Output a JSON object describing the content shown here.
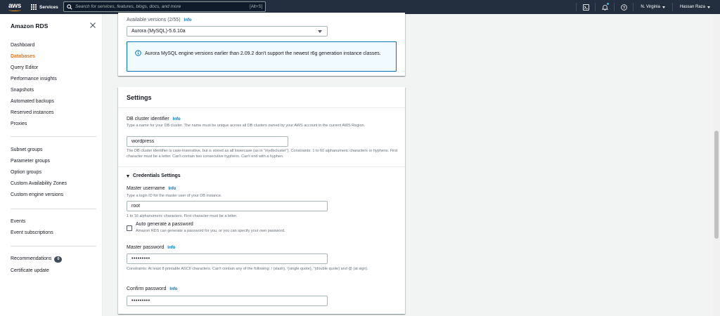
{
  "topnav": {
    "logo_text": "aws",
    "services_label": "Services",
    "search_placeholder": "Search for services, features, blogs, docs, and more",
    "search_shortcut": "[Alt+S]",
    "region": "N. Virginia",
    "user": "Hassan Raza",
    "icons": [
      "cloudshell-icon",
      "bell-icon",
      "help-icon"
    ],
    "notification_dot_color": "#44b9d6"
  },
  "sidebar": {
    "title": "Amazon RDS",
    "groups": [
      [
        {
          "label": "Dashboard",
          "active": false
        },
        {
          "label": "Databases",
          "active": true
        },
        {
          "label": "Query Editor",
          "active": false
        },
        {
          "label": "Performance insights",
          "active": false
        },
        {
          "label": "Snapshots",
          "active": false
        },
        {
          "label": "Automated backups",
          "active": false
        },
        {
          "label": "Reserved instances",
          "active": false
        },
        {
          "label": "Proxies",
          "active": false
        }
      ],
      [
        {
          "label": "Subnet groups",
          "active": false
        },
        {
          "label": "Parameter groups",
          "active": false
        },
        {
          "label": "Option groups",
          "active": false
        },
        {
          "label": "Custom Availability Zones",
          "active": false
        },
        {
          "label": "Custom engine versions",
          "active": false
        }
      ],
      [
        {
          "label": "Events",
          "active": false
        },
        {
          "label": "Event subscriptions",
          "active": false
        }
      ],
      [
        {
          "label": "Recommendations",
          "active": false,
          "badge": "0"
        },
        {
          "label": "Certificate update",
          "active": false
        }
      ]
    ],
    "active_color": "#ec7211"
  },
  "versions": {
    "label": "Available versions (2/55)",
    "info": "Info",
    "selected": "Aurora (MySQL)-5.6.10a",
    "alert": "Aurora MySQL engine versions earlier than 2.09.2 don't support the newest r6g generation instance classes."
  },
  "settings": {
    "title": "Settings",
    "cluster_id": {
      "label": "DB cluster identifier",
      "info": "Info",
      "description": "Type a name for your DB cluster. The name must be unique across all DB clusters owned by your AWS account in the current AWS Region.",
      "value": "wordpress",
      "constraints": "The DB cluster identifier is case-insensitive, but is stored as all lowercase (as in \"mydbcluster\"). Constraints: 1 to 60 alphanumeric characters or hyphens. First character must be a letter. Can't contain two consecutive hyphens. Can't end with a hyphen."
    },
    "credentials_heading": "Credentials Settings",
    "master_username": {
      "label": "Master username",
      "info": "Info",
      "description": "Type a login ID for the master user of your DB instance.",
      "value": "root",
      "constraints": "1 to 16 alphanumeric characters. First character must be a letter."
    },
    "auto_generate": {
      "label": "Auto generate a password",
      "description": "Amazon RDS can generate a password for you, or you can specify your own password.",
      "checked": false
    },
    "master_password": {
      "label": "Master password",
      "info": "Info",
      "value": "•••••••••",
      "constraints": "Constraints: At least 8 printable ASCII characters. Can't contain any of the following: / (slash), '(single quote), \"(double quote) and @ (at sign)."
    },
    "confirm_password": {
      "label": "Confirm password",
      "info": "Info",
      "value": "•••••••••"
    }
  }
}
